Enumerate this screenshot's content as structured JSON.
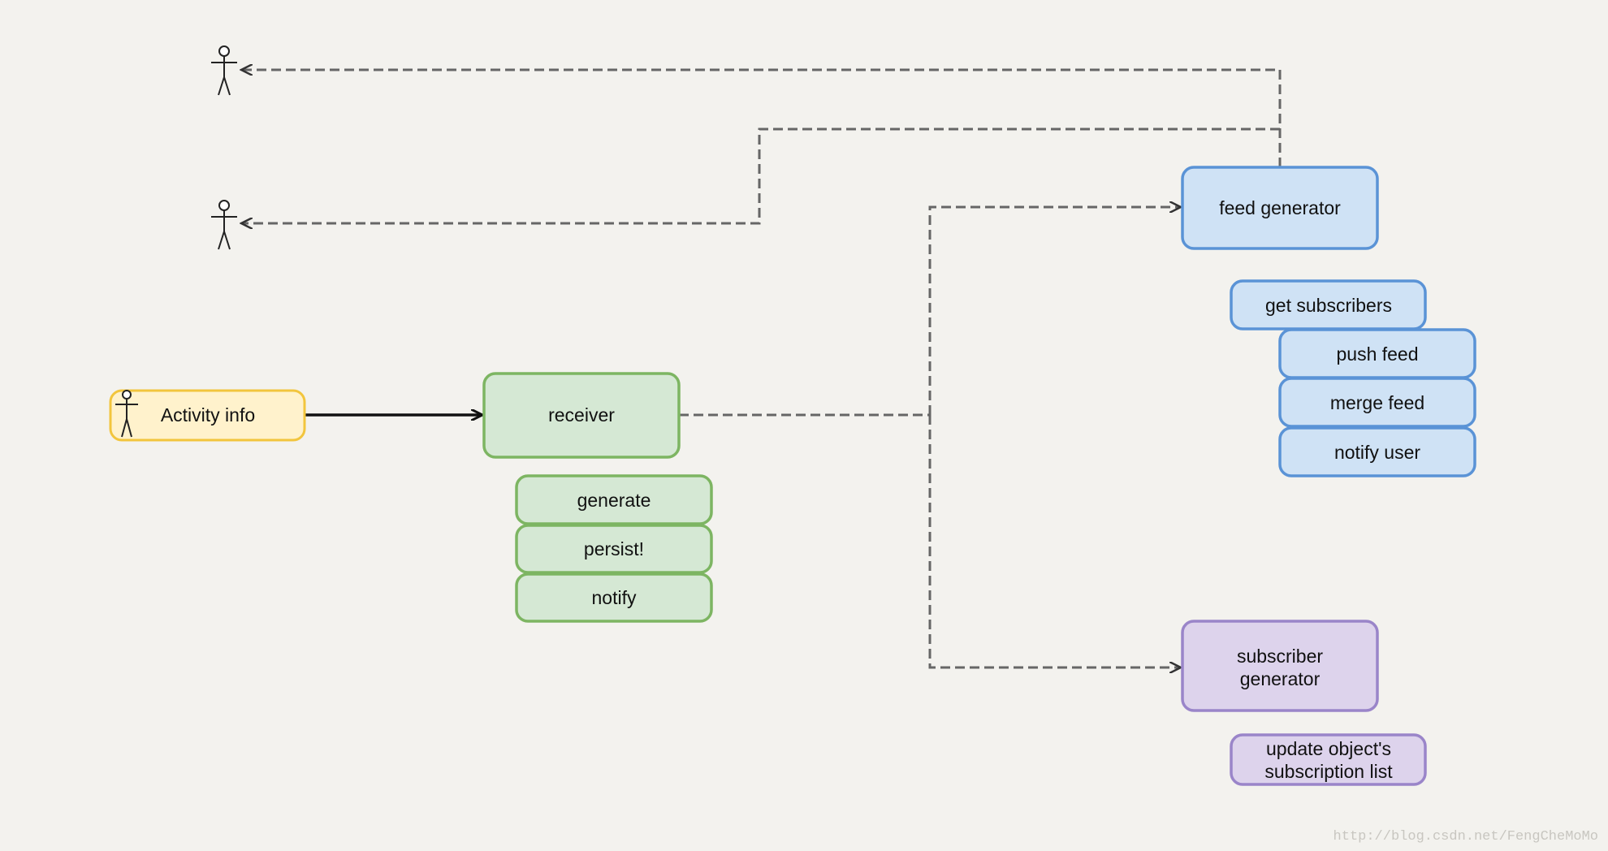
{
  "colors": {
    "background": "#f3f2ee",
    "green_fill": "#d5e8d4",
    "green_stroke": "#7db562",
    "blue_fill": "#cfe2f5",
    "blue_stroke": "#5a93d6",
    "purple_fill": "#ddd3ec",
    "purple_stroke": "#9a85c9",
    "yellow_fill": "#fff2cc",
    "yellow_stroke": "#f2c53d"
  },
  "nodes": {
    "activity_info": "Activity info",
    "receiver": "receiver",
    "receiver_steps": [
      "generate",
      "persist!",
      "notify"
    ],
    "feed_generator": "feed generator",
    "feed_steps": [
      "get subscribers",
      "push feed",
      "merge feed",
      "notify user"
    ],
    "subscriber_generator": [
      "subscriber",
      "generator"
    ],
    "subscriber_steps": [
      "update object's",
      "subscription list"
    ]
  },
  "icons": [
    "actor-icon"
  ],
  "watermark": "http://blog.csdn.net/FengCheMoMo"
}
